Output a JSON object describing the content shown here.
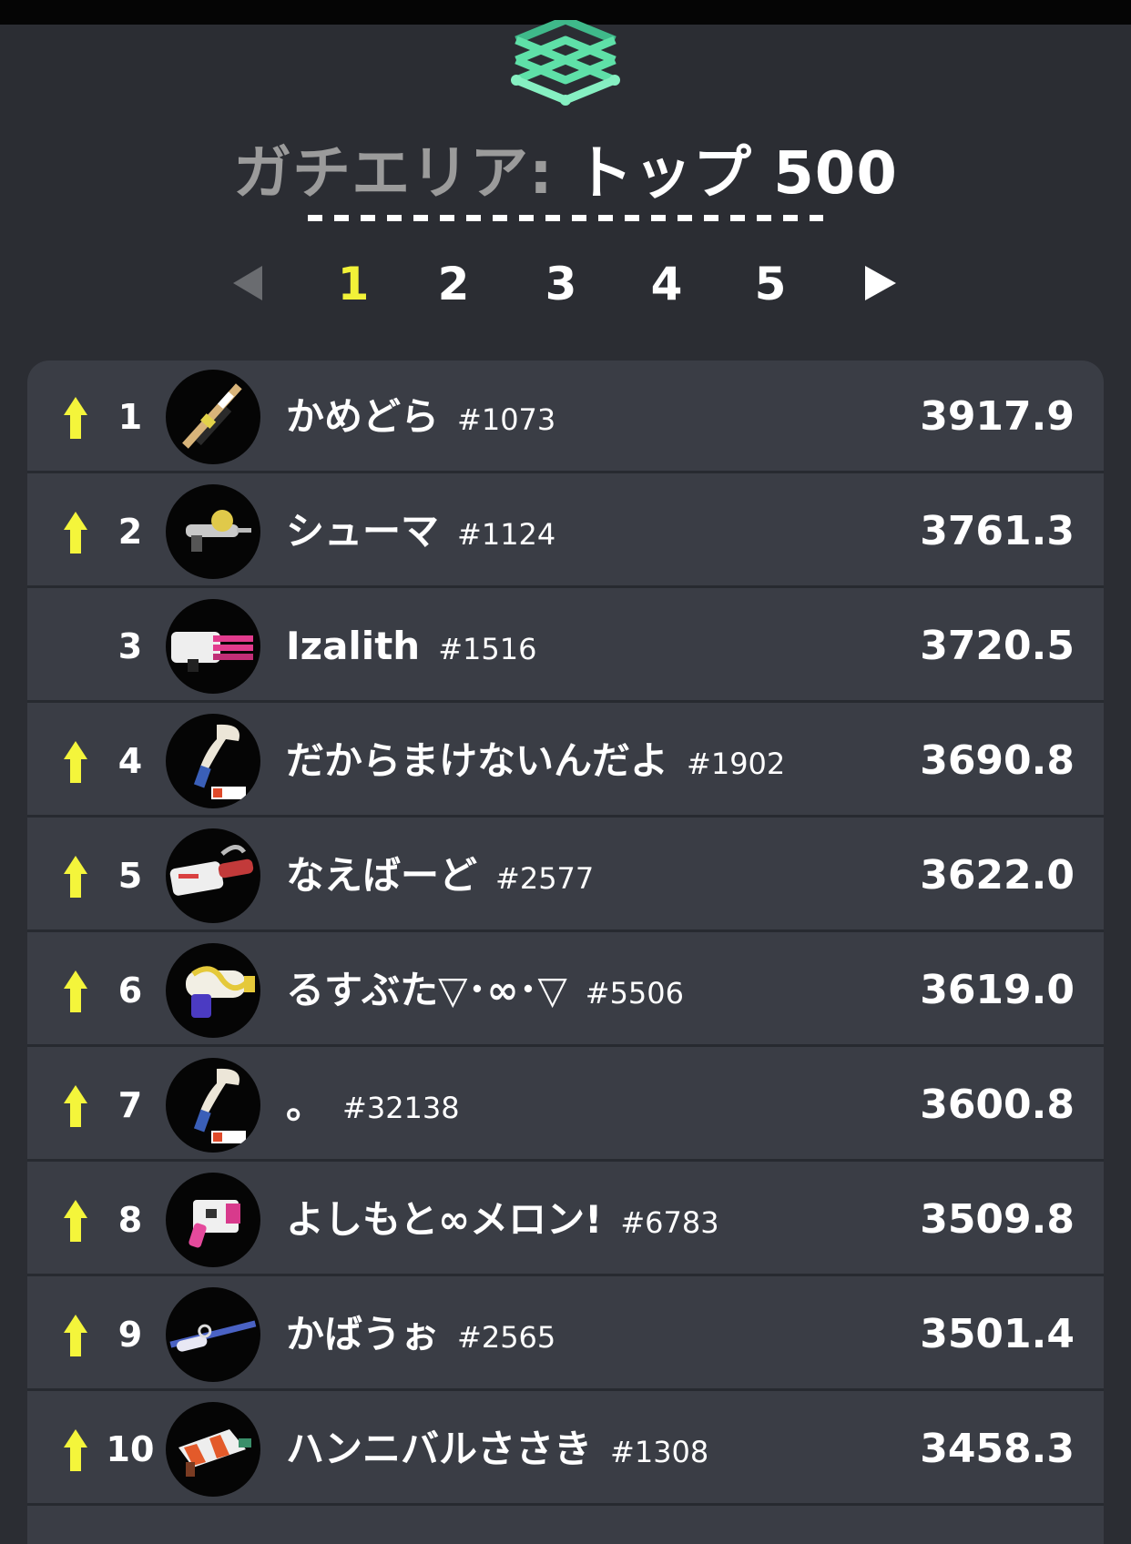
{
  "header": {
    "mode": "ガチエリア",
    "separator": ":",
    "rank_label": "トップ 500"
  },
  "pager": {
    "pages": [
      "1",
      "2",
      "3",
      "4",
      "5"
    ],
    "active_page": "1"
  },
  "colors": {
    "background": "#2b2d33",
    "panel": "#3a3d45",
    "accent_yellow": "#f2f238",
    "logo_green": "#5fe0a8"
  },
  "leaderboard": [
    {
      "rank": "1",
      "name": "かめどら",
      "tag": "#1073",
      "power": "3917.9",
      "trend": "up",
      "weapon": "charger-weapon-icon"
    },
    {
      "rank": "2",
      "name": "シューマ",
      "tag": "#1124",
      "power": "3761.3",
      "trend": "up",
      "weapon": "splattershot-weapon-icon"
    },
    {
      "rank": "3",
      "name": "Izalith",
      "tag": "#1516",
      "power": "3720.5",
      "trend": "none",
      "weapon": "splatling-weapon-icon"
    },
    {
      "rank": "4",
      "name": "だからまけないんだよ",
      "tag": "#1902",
      "power": "3690.8",
      "trend": "up",
      "weapon": "squeezer-weapon-icon"
    },
    {
      "rank": "5",
      "name": "なえばーど",
      "tag": "#2577",
      "power": "3622.0",
      "trend": "up",
      "weapon": "hydra-weapon-icon"
    },
    {
      "rank": "6",
      "name": "るすぶた▽･∞･▽",
      "tag": "#5506",
      "power": "3619.0",
      "trend": "up",
      "weapon": "blaster-weapon-icon"
    },
    {
      "rank": "7",
      "name": "。",
      "tag": "#32138",
      "power": "3600.8",
      "trend": "up",
      "weapon": "squeezer-weapon-icon"
    },
    {
      "rank": "8",
      "name": "よしもと∞メロン!",
      "tag": "#6783",
      "power": "3509.8",
      "trend": "up",
      "weapon": "dualie-weapon-icon"
    },
    {
      "rank": "9",
      "name": "かばうぉ",
      "tag": "#2565",
      "power": "3501.4",
      "trend": "up",
      "weapon": "liter-weapon-icon"
    },
    {
      "rank": "10",
      "name": "ハンニバルささき",
      "tag": "#1308",
      "power": "3458.3",
      "trend": "up",
      "weapon": "brella-weapon-icon"
    }
  ]
}
